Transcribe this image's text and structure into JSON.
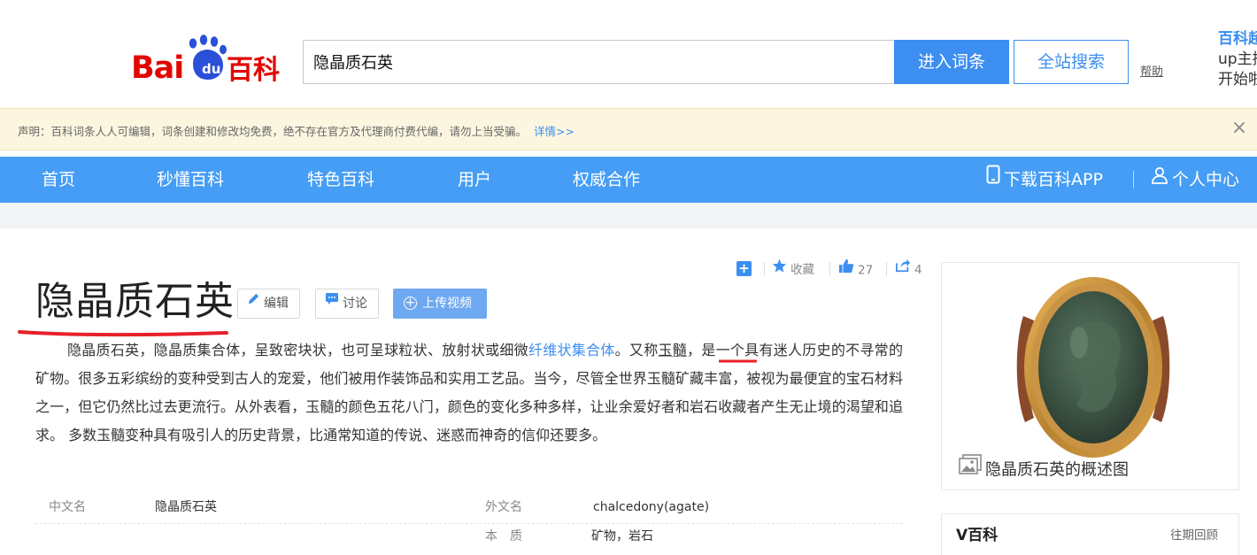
{
  "header": {
    "logo_text": "Bai百科",
    "search_value": "隐晶质石英",
    "enter_button": "进入词条",
    "site_search_button": "全站搜索",
    "help_link": "帮助",
    "promo_line1": "百科超",
    "promo_line2": "up主播",
    "promo_line3": "开始啦"
  },
  "notice": {
    "text": "声明：百科词条人人可编辑，词条创建和修改均免费，绝不存在官方及代理商付费代编，请勿上当受骗。",
    "link": "详情>>",
    "close_icon": "close-icon"
  },
  "nav": {
    "items": [
      "首页",
      "秒懂百科",
      "特色百科",
      "用户",
      "权威合作"
    ],
    "download_app": "下载百科APP",
    "personal_center": "个人中心"
  },
  "toolbar": {
    "add_icon": "plus-icon",
    "collect_label": "收藏",
    "like_count": "27",
    "share_count": "4"
  },
  "entry": {
    "title": "隐晶质石英",
    "edit_label": "编辑",
    "discuss_label": "讨论",
    "upload_video_label": "上传视频"
  },
  "summary": {
    "part1": "隐晶质石英，隐晶质集合体，呈致密块状，也可呈球粒状、放射状或细微",
    "link1": "纤维状集合体",
    "part2": "。又称",
    "link2": "玉髓",
    "part3": "，是一个具有迷人历史的不寻常的矿物。很多五彩缤纷的变种受到古人的宠爱，他们被用作装饰品和实用工艺品。当今，尽管全世界玉髓矿藏丰富，被视为最便宜的宝石材料之一，但它仍然比过去更流行。从外表看，玉髓的颜色五花八门，颜色的变化多种多样，让业余爱好者和岩石收藏者产生无止境的渴望和追求。 多数玉髓变种具有吸引人的历史背景，比通常知道的传说、迷惑而神奇的信仰还要多。"
  },
  "basic_info": {
    "chinese_name_label": "中文名",
    "chinese_name_value": "隐晶质石英",
    "foreign_name_label": "外文名",
    "foreign_name_value": "chalcedony(agate)",
    "essence_label": "本　质",
    "essence_value": "矿物，岩石"
  },
  "sidebar": {
    "photo_caption": "隐晶质石英的概述图",
    "vbaike_title": "V百科",
    "vbaike_link": "往期回顾"
  },
  "colors": {
    "brand_blue": "#3c8ef0",
    "nav_blue": "#459df5",
    "logo_red": "#e10601",
    "notice_bg": "#fcf6e0",
    "title_mark_red": "#e8202a"
  }
}
